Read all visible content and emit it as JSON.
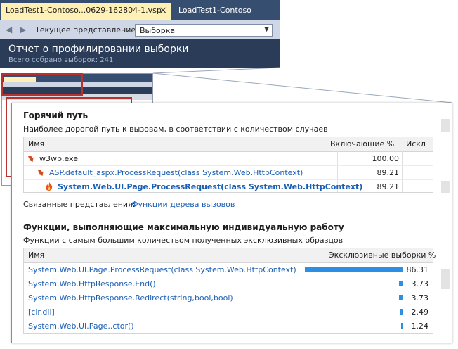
{
  "tabs": [
    {
      "label": "LoadTest1-Contoso...0629-162804-1.vsp",
      "active": true
    },
    {
      "label": "LoadTest1-Contoso",
      "active": false
    }
  ],
  "toolbar": {
    "view_label": "Текущее представление:",
    "view_value": "Выборка"
  },
  "report": {
    "title": "Отчет о профилировании выборки",
    "subtitle": "Всего собрано выборок: 241"
  },
  "hot_path": {
    "title": "Горячий путь",
    "description": "Наиболее дорогой путь к вызовам, в соответствии с количеством случаев",
    "columns": [
      "Имя",
      "Включающие %",
      "Искл"
    ],
    "rows": [
      {
        "name": "w3wp.exe",
        "inclusive": "100.00",
        "icon": "hot-path-arrow-icon"
      },
      {
        "name": "ASP.default_aspx.ProcessRequest(class System.Web.HttpContext)",
        "inclusive": "89.21",
        "icon": "hot-path-arrow-icon"
      },
      {
        "name": "System.Web.UI.Page.ProcessRequest(class System.Web.HttpContext)",
        "inclusive": "89.21",
        "icon": "flame-icon"
      }
    ]
  },
  "related": {
    "label": "Связанные представления:",
    "link": "Функции дерева вызовов"
  },
  "top_functions": {
    "title": "Функции, выполняющие максимальную индивидуальную работу",
    "description": "Функции с самым большим количеством полученных эксклюзивных образцов",
    "columns": [
      "Имя",
      "Эксклюзивные выборки %"
    ],
    "rows": [
      {
        "name": "System.Web.UI.Page.ProcessRequest(class System.Web.HttpContext)",
        "value": "86.31",
        "fraction": 0.8631
      },
      {
        "name": "System.Web.HttpResponse.End()",
        "value": "3.73",
        "fraction": 0.0373
      },
      {
        "name": "System.Web.HttpResponse.Redirect(string,bool,bool)",
        "value": "3.73",
        "fraction": 0.0373
      },
      {
        "name": "[clr.dll]",
        "value": "2.49",
        "fraction": 0.0249
      },
      {
        "name": "System.Web.UI.Page..ctor()",
        "value": "1.24",
        "fraction": 0.0124
      }
    ]
  },
  "colors": {
    "accent_bar": "#2d8fe3",
    "link": "#1b5fb4",
    "hot_arrow": "#d24a1e",
    "active_tab": "#fff1b5"
  }
}
